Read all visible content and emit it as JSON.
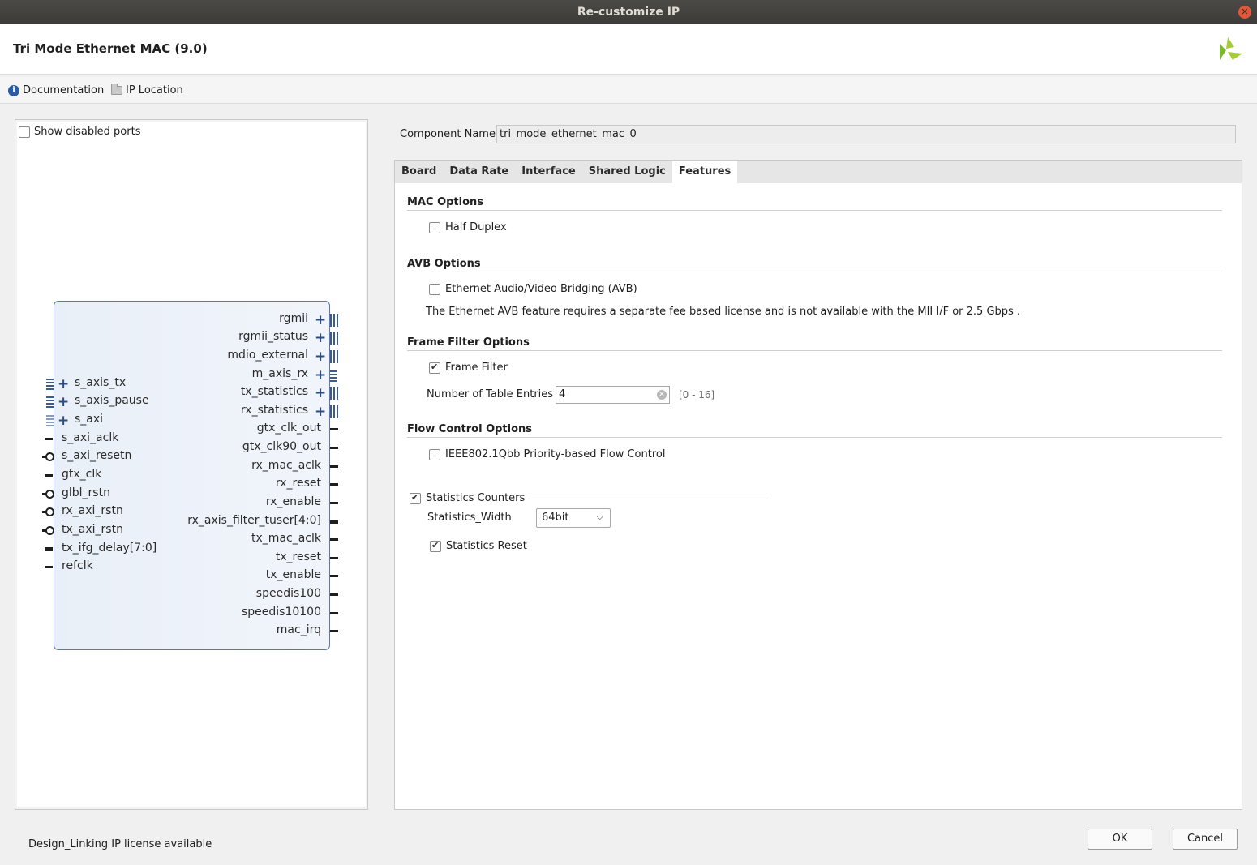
{
  "window": {
    "title": "Re-customize IP"
  },
  "header": {
    "title": "Tri Mode Ethernet MAC (9.0)"
  },
  "toolbar": {
    "documentation": "Documentation",
    "ip_location": "IP Location"
  },
  "left_panel": {
    "show_disabled": "Show disabled ports",
    "ports_right": [
      "rgmii",
      "rgmii_status",
      "mdio_external",
      "m_axis_rx",
      "tx_statistics",
      "rx_statistics",
      "gtx_clk_out",
      "gtx_clk90_out",
      "rx_mac_aclk",
      "rx_reset",
      "rx_enable",
      "rx_axis_filter_tuser[4:0]",
      "tx_mac_aclk",
      "tx_reset",
      "tx_enable",
      "speedis100",
      "speedis10100",
      "mac_irq"
    ],
    "ports_left": [
      "s_axis_tx",
      "s_axis_pause",
      "s_axi",
      "s_axi_aclk",
      "s_axi_resetn",
      "gtx_clk",
      "glbl_rstn",
      "rx_axi_rstn",
      "tx_axi_rstn",
      "tx_ifg_delay[7:0]",
      "refclk"
    ]
  },
  "component": {
    "label": "Component Name",
    "value": "tri_mode_ethernet_mac_0"
  },
  "tabs": [
    "Board",
    "Data Rate",
    "Interface",
    "Shared Logic",
    "Features"
  ],
  "features": {
    "mac_options": {
      "title": "MAC Options",
      "half_duplex": "Half Duplex"
    },
    "avb_options": {
      "title": "AVB Options",
      "avb": "Ethernet Audio/Video Bridging (AVB)",
      "note": "The Ethernet AVB feature requires a separate fee based license and is not available with the MII I/F or 2.5 Gbps ."
    },
    "frame_filter": {
      "title": "Frame Filter Options",
      "checkbox": "Frame Filter",
      "entries_label": "Number of Table Entries",
      "entries_value": "4",
      "entries_range": "[0 - 16]"
    },
    "flow_control": {
      "title": "Flow Control Options",
      "checkbox": "IEEE802.1Qbb Priority-based Flow Control"
    },
    "statistics": {
      "counters": "Statistics Counters",
      "width_label": "Statistics_Width",
      "width_value": "64bit",
      "reset": "Statistics Reset"
    }
  },
  "footer": {
    "status": "Design_Linking IP license available",
    "ok": "OK",
    "cancel": "Cancel"
  },
  "colors": {
    "accent": "#2a4e84",
    "titlebar": "#3c3b37"
  }
}
